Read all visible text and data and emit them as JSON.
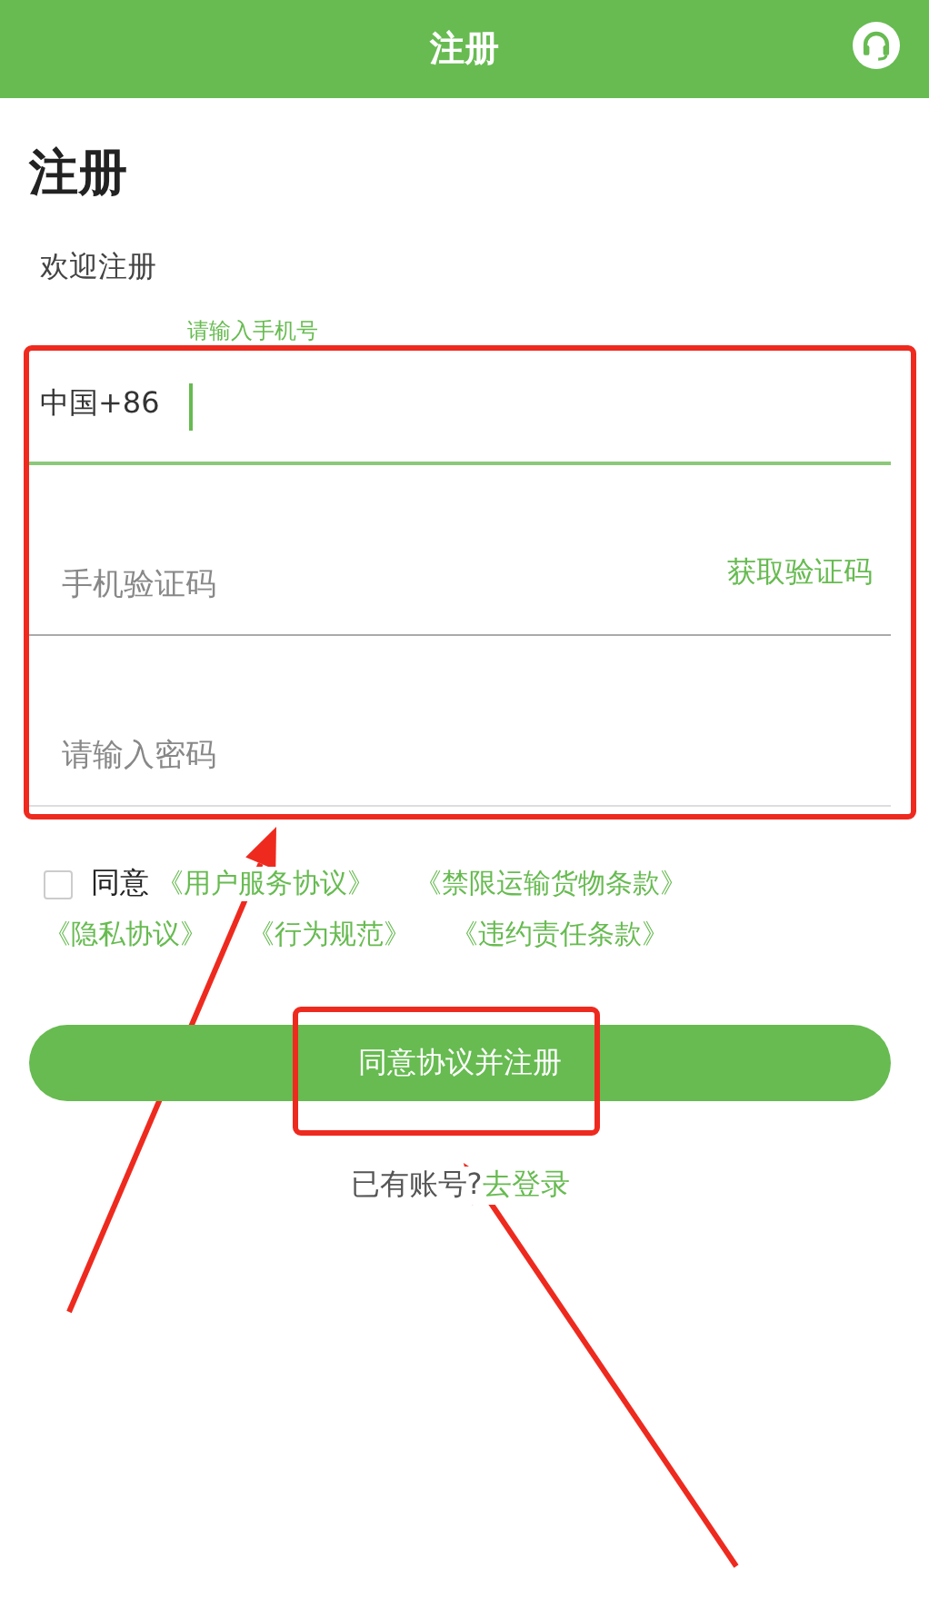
{
  "header": {
    "title": "注册"
  },
  "page_title": "注册",
  "subtitle": "欢迎注册",
  "phone": {
    "country_code": "中国+86",
    "floating_label": "请输入手机号",
    "focused": true
  },
  "code": {
    "placeholder": "手机验证码",
    "action": "获取验证码"
  },
  "password": {
    "placeholder": "请输入密码"
  },
  "agreement": {
    "checked": false,
    "label": "同意",
    "links": [
      "《用户服务协议》",
      "《禁限运输货物条款》",
      "《隐私协议》",
      "《行为规范》",
      "《违约责任条款》"
    ]
  },
  "submit": "同意协议并注册",
  "login": {
    "text": "已有账号?",
    "link": "去登录"
  },
  "annotations": [
    {
      "kind": "box"
    },
    {
      "kind": "box"
    },
    {
      "kind": "arrow"
    },
    {
      "kind": "arrow"
    }
  ]
}
